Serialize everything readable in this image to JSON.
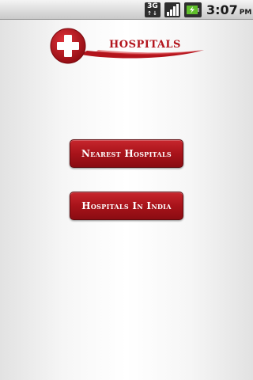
{
  "status_bar": {
    "network_label": "3G",
    "time": "3:07",
    "ampm": "PM",
    "icons": [
      "network-3g-icon",
      "signal-strength-icon",
      "battery-charging-icon"
    ]
  },
  "header": {
    "title": "HOSPITALS",
    "logo_icon": "medical-cross-icon"
  },
  "buttons": {
    "nearest": "Nearest Hospitals",
    "india": "Hospitals In India"
  },
  "colors": {
    "brand_red": "#b3141c",
    "button_red": "#a8131a",
    "text_on_button": "#ffffff"
  }
}
